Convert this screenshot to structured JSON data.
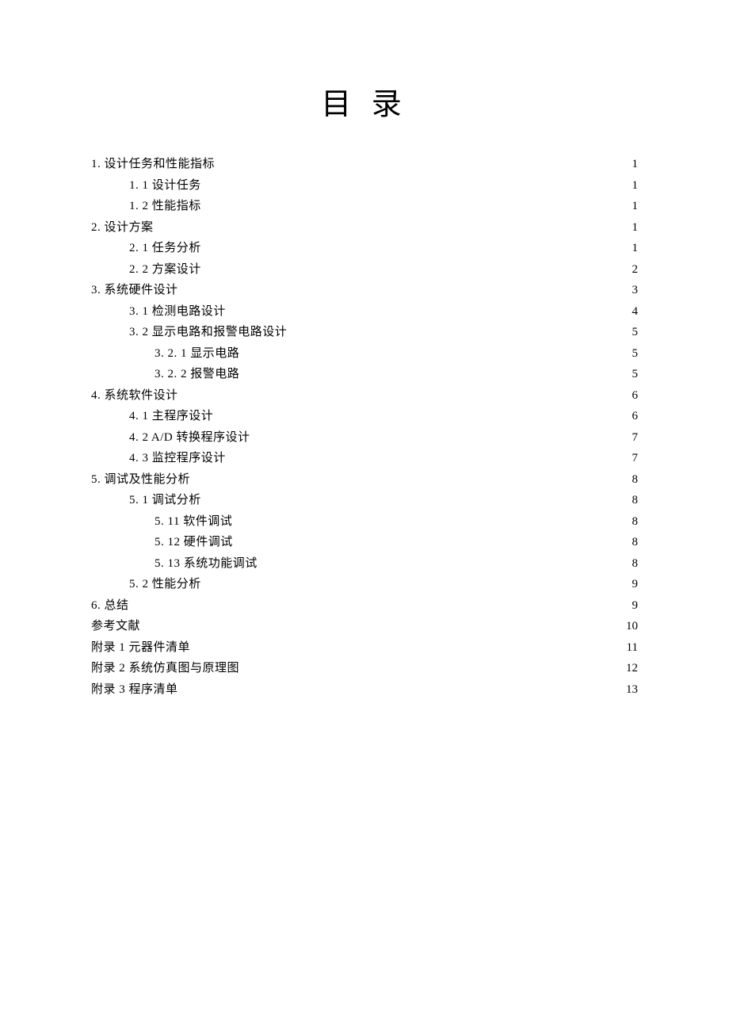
{
  "title": "目 录",
  "toc": [
    {
      "label": "1. 设计任务和性能指标",
      "page": "1",
      "indent": 0
    },
    {
      "label": "1. 1 设计任务",
      "page": "1",
      "indent": 1
    },
    {
      "label": "1. 2 性能指标",
      "page": "1",
      "indent": 1
    },
    {
      "label": "2. 设计方案",
      "page": "1",
      "indent": 0
    },
    {
      "label": "2. 1 任务分析",
      "page": "1",
      "indent": 1
    },
    {
      "label": "2. 2 方案设计",
      "page": "2",
      "indent": 1
    },
    {
      "label": "3.  系统硬件设计",
      "page": "3",
      "indent": 0
    },
    {
      "label": "3. 1 检测电路设计",
      "page": "4",
      "indent": 1
    },
    {
      "label": "3. 2 显示电路和报警电路设计",
      "page": "5",
      "indent": 1
    },
    {
      "label": "3. 2. 1 显示电路",
      "page": "5",
      "indent": 2
    },
    {
      "label": "3. 2. 2 报警电路",
      "page": "5",
      "indent": 2
    },
    {
      "label": "4.  系统软件设计",
      "page": "6",
      "indent": 0
    },
    {
      "label": "4. 1 主程序设计",
      "page": "6",
      "indent": 1
    },
    {
      "label": "4. 2 A/D 转换程序设计",
      "page": "7",
      "indent": 1
    },
    {
      "label": "4. 3 监控程序设计",
      "page": "7",
      "indent": 1
    },
    {
      "label": "5.  调试及性能分析",
      "page": "8",
      "indent": 0
    },
    {
      "label": "5. 1 调试分析",
      "page": "8",
      "indent": 1
    },
    {
      "label": "5. 11 软件调试",
      "page": "8",
      "indent": 2
    },
    {
      "label": "5. 12 硬件调试",
      "page": "8",
      "indent": 2
    },
    {
      "label": "5. 13 系统功能调试",
      "page": "8",
      "indent": 2
    },
    {
      "label": "5. 2 性能分析",
      "page": "9",
      "indent": 1
    },
    {
      "label": "6.  总结",
      "page": "9",
      "indent": 0
    },
    {
      "label": "参考文献",
      "page": "10",
      "indent": 0
    },
    {
      "label": "附录 1  元器件清单",
      "page": "11",
      "indent": 0
    },
    {
      "label": "附录 2  系统仿真图与原理图",
      "page": "12",
      "indent": 0
    },
    {
      "label": "附录 3  程序清单",
      "page": "13",
      "indent": 0
    }
  ]
}
